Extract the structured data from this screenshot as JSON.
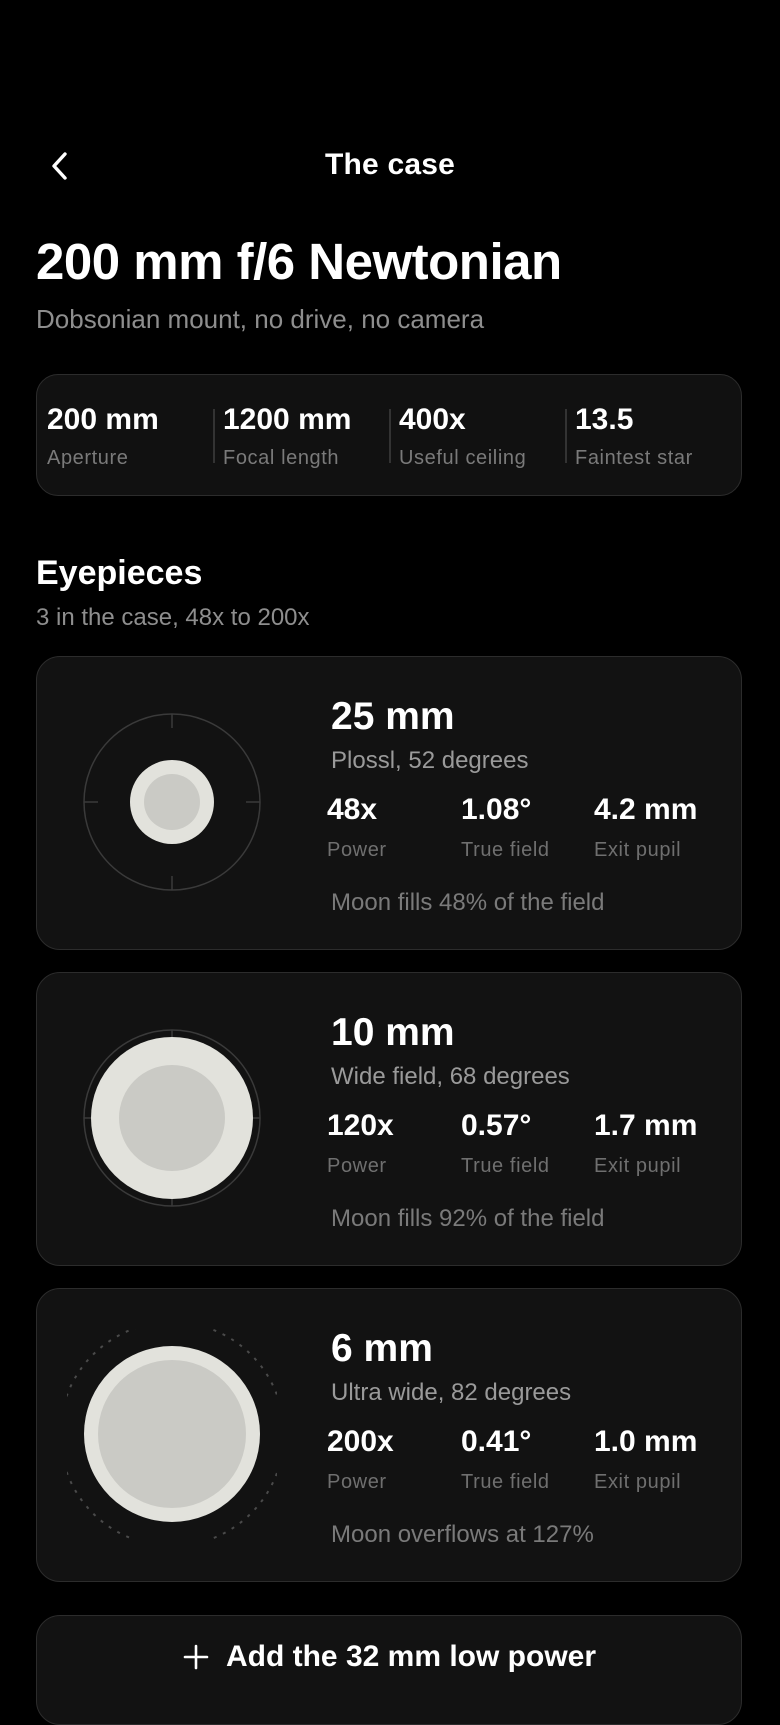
{
  "header": {
    "back_icon": "chevron-left-icon",
    "title": "The case"
  },
  "telescope": {
    "name": "200 mm f/6 Newtonian",
    "subtitle": "Dobsonian mount, no drive, no camera"
  },
  "specs": [
    {
      "value": "200 mm",
      "label": "Aperture"
    },
    {
      "value": "1200 mm",
      "label": "Focal length"
    },
    {
      "value": "400x",
      "label": "Useful ceiling"
    },
    {
      "value": "13.5",
      "label": "Faintest star"
    }
  ],
  "eyepieces_section": {
    "title": "Eyepieces",
    "subtitle": "3 in the case, 48x to 200x"
  },
  "eyepieces": [
    {
      "focal": "25 mm",
      "type": "Plossl, 52 degrees",
      "power": "48x",
      "power_label": "Power",
      "true_field": "1.08°",
      "true_field_label": "True field",
      "exit_pupil": "4.2 mm",
      "exit_pupil_label": "Exit pupil",
      "note": "Moon fills 48% of the field",
      "moon_fill": 0.48,
      "overflows": false
    },
    {
      "focal": "10 mm",
      "type": "Wide field, 68 degrees",
      "power": "120x",
      "power_label": "Power",
      "true_field": "0.57°",
      "true_field_label": "True field",
      "exit_pupil": "1.7 mm",
      "exit_pupil_label": "Exit pupil",
      "note": "Moon fills 92% of the field",
      "moon_fill": 0.92,
      "overflows": false
    },
    {
      "focal": "6 mm",
      "type": "Ultra wide, 82 degrees",
      "power": "200x",
      "power_label": "Power",
      "true_field": "0.41°",
      "true_field_label": "True field",
      "exit_pupil": "1.0 mm",
      "exit_pupil_label": "Exit pupil",
      "note": "Moon overflows at 127%",
      "moon_fill": 1.27,
      "overflows": true
    }
  ],
  "add_button": {
    "icon": "plus-icon",
    "label": "Add the 32 mm low power"
  },
  "colors": {
    "background": "#000000",
    "card": "#121212",
    "border": "#2c2c2c",
    "moon_outer": "#e2e2dc",
    "moon_inner": "#cacac5",
    "muted_text": "#8e8e8e"
  }
}
